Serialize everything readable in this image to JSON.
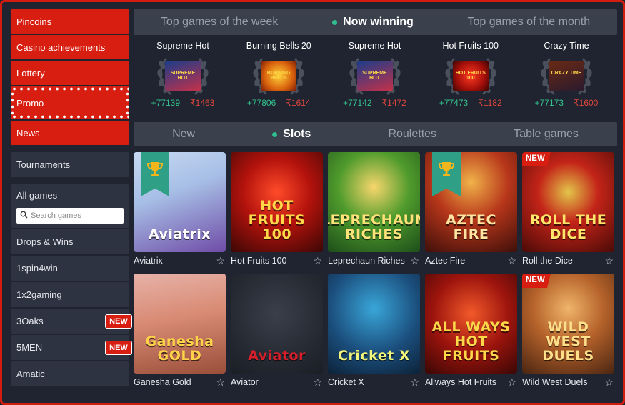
{
  "sidebar": {
    "red_items": [
      "Pincoins",
      "Casino achievements",
      "Lottery"
    ],
    "promo": "Promo",
    "news": "News",
    "tournaments": "Tournaments",
    "all_games": "All games",
    "search_placeholder": "Search games",
    "providers": [
      {
        "label": "Drops & Wins",
        "badge": ""
      },
      {
        "label": "1spin4win",
        "badge": ""
      },
      {
        "label": "1x2gaming",
        "badge": ""
      },
      {
        "label": "3Oaks",
        "badge": "NEW"
      },
      {
        "label": "5MEN",
        "badge": "NEW"
      },
      {
        "label": "Amatic",
        "badge": ""
      }
    ]
  },
  "top_tabs": [
    "Top games of the week",
    "Now winning",
    "Top games of the month"
  ],
  "winners": [
    {
      "game": "Supreme Hot",
      "win": "+77139",
      "bet": "₹1463",
      "thumb_text": "SUPREME HOT"
    },
    {
      "game": "Burning Bells 20",
      "win": "+77806",
      "bet": "₹1614",
      "thumb_text": "BURNING BELLS"
    },
    {
      "game": "Supreme Hot",
      "win": "+77142",
      "bet": "₹1472",
      "thumb_text": "SUPREME HOT"
    },
    {
      "game": "Hot Fruits 100",
      "win": "+77473",
      "bet": "₹1182",
      "thumb_text": "HOT FRUITS 100"
    },
    {
      "game": "Crazy Time",
      "win": "+77173",
      "bet": "₹1600",
      "thumb_text": "CRAZY TIME"
    }
  ],
  "category_tabs": [
    "New",
    "Slots",
    "Roulettes",
    "Table games"
  ],
  "games": [
    {
      "name": "Aviatrix",
      "art": "Aviatrix",
      "badge": "trophy",
      "bg": "linear-gradient(160deg,#c8d9f2 0%,#a7bfe6 40%,#6f4ca7 100%)",
      "title_color": "#ffffff"
    },
    {
      "name": "Hot Fruits 100",
      "art": "HOT FRUITS 100",
      "badge": "",
      "bg": "radial-gradient(circle at 50% 40%,#ff4b2a 0%,#b3120c 45%,#3b0705 100%)",
      "title_color": "#ffd84a"
    },
    {
      "name": "Leprechaun Riches",
      "art": "LEPRECHAUN RICHES",
      "badge": "",
      "bg": "radial-gradient(circle at 50% 35%,#f7d66c 0%,#4f9b2c 45%,#1d4d1a 100%)",
      "title_color": "#ffe27a"
    },
    {
      "name": "Aztec Fire",
      "art": "AZTEC FIRE",
      "badge": "trophy",
      "bg": "radial-gradient(circle at 50% 30%,#f1b24a 0%,#b7361a 45%,#3e0f0a 100%)",
      "title_color": "#ffe3a0"
    },
    {
      "name": "Roll the Dice",
      "art": "ROLL THE DICE",
      "badge": "NEW",
      "bg": "radial-gradient(circle at 50% 40%,#e3c54a 0%,#c32418 40%,#4a0a07 100%)",
      "title_color": "#ffe56a"
    },
    {
      "name": "Ganesha Gold",
      "art": "Ganesha GOLD",
      "badge": "",
      "bg": "linear-gradient(170deg,#e7b2a8 0%,#d88a73 45%,#9a4f3b 100%)",
      "title_color": "#ffd24a"
    },
    {
      "name": "Aviator",
      "art": "Aviator",
      "badge": "",
      "bg": "radial-gradient(circle at 50% 40%,#3a3f4a 0%,#262a33 60%,#1b1e25 100%)",
      "title_color": "#d51f2a"
    },
    {
      "name": "Cricket X",
      "art": "Cricket X",
      "badge": "",
      "bg": "radial-gradient(circle at 50% 35%,#39a6d8 0%,#1b4f7e 55%,#0c2238 100%)",
      "title_color": "#f2f57a"
    },
    {
      "name": "Allways Hot Fruits",
      "art": "ALL WAYS HOT FRUITS",
      "badge": "",
      "bg": "radial-gradient(circle at 50% 40%,#f25a2a 0%,#9d140d 50%,#3a0705 100%)",
      "title_color": "#ffd84a"
    },
    {
      "name": "Wild West Duels",
      "art": "WILD WEST DUELS",
      "badge": "NEW",
      "bg": "radial-gradient(circle at 50% 35%,#f0b56a 0%,#b5622a 45%,#4a2512 100%)",
      "title_color": "#ffe08a"
    }
  ],
  "colors": {
    "accent_red": "#d71e10",
    "win_green": "#33c28d",
    "bet_red": "#e0463b",
    "panel": "#2d3340",
    "background": "#1f2430"
  },
  "icons": {
    "search": "search-icon",
    "favorite": "star-icon",
    "leader": "trophy-icon",
    "laurel": "laurel-wreath-icon",
    "live": "dot-icon"
  }
}
